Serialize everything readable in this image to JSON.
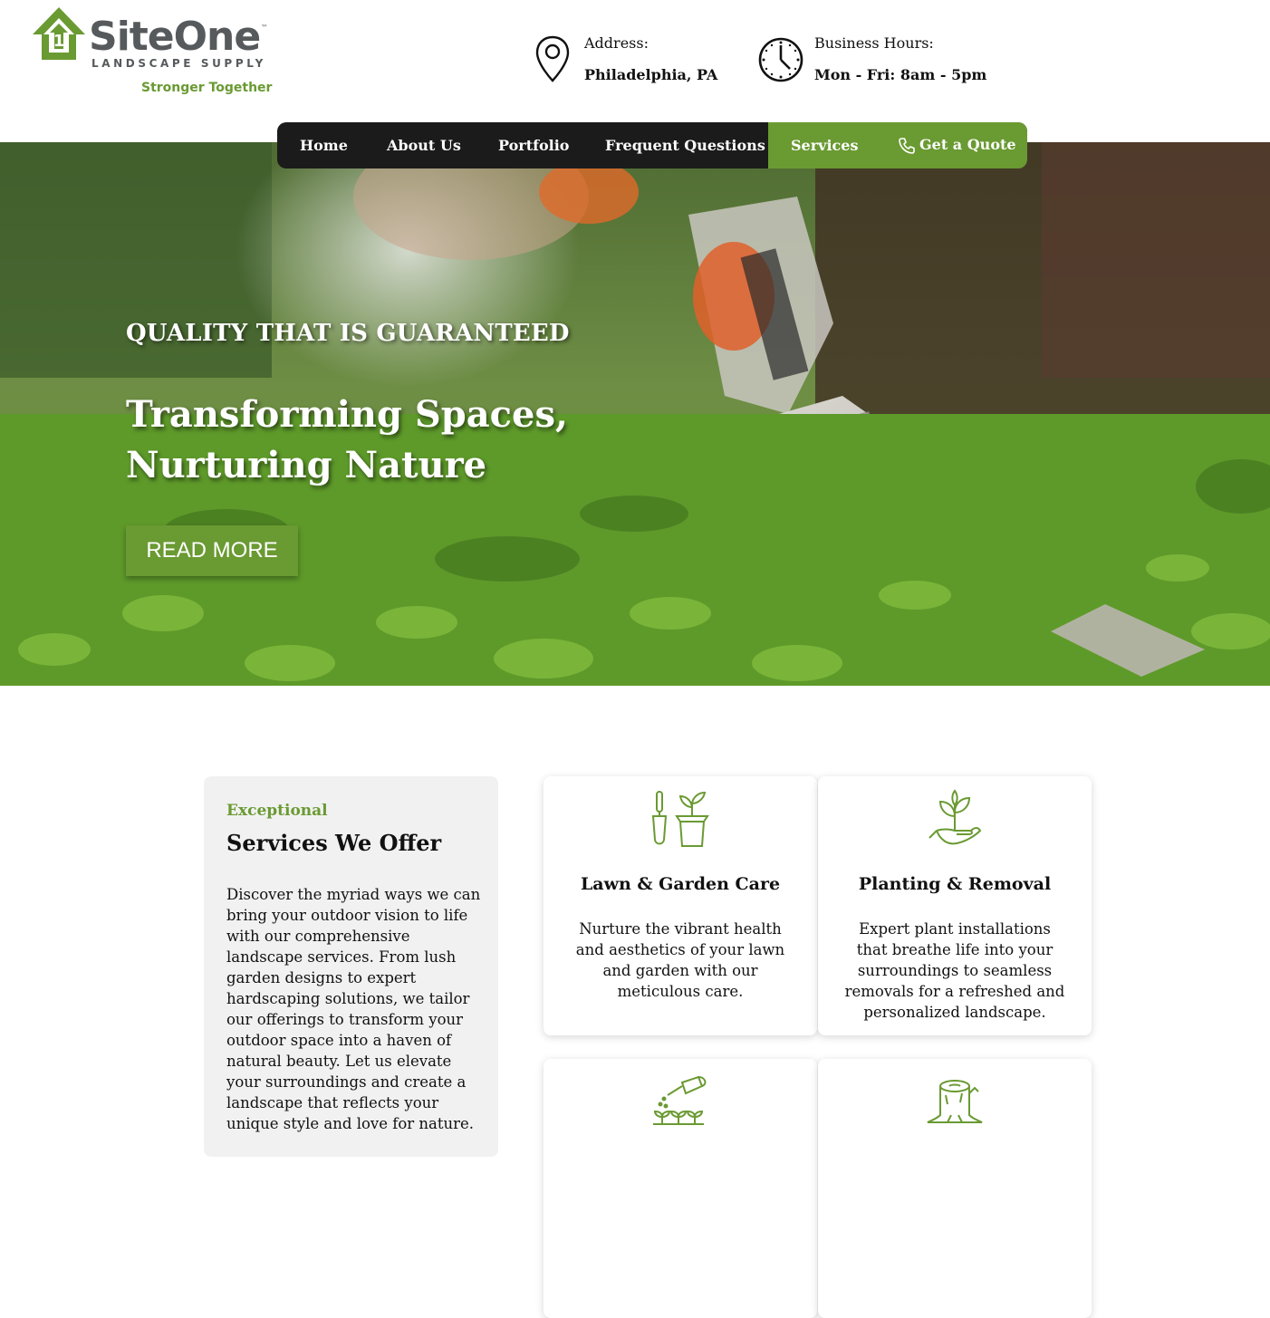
{
  "brand": {
    "name": "SiteOne",
    "tm": "™",
    "subtitle": "LANDSCAPE SUPPLY",
    "tagline": "Stronger Together"
  },
  "contact": {
    "address_label": "Address:",
    "address_value": "Philadelphia, PA",
    "hours_label": "Business Hours:",
    "hours_value": "Mon - Fri: 8am - 5pm"
  },
  "nav": {
    "items": [
      "Home",
      "About Us",
      "Portfolio",
      "Frequent Questions",
      "Services"
    ],
    "quote_label": "Get a Quote"
  },
  "hero": {
    "kicker": "QUALITY THAT IS GUARANTEED",
    "title_line1": "Transforming Spaces,",
    "title_line2": "Nurturing Nature",
    "button_label": "READ MORE"
  },
  "services_intro": {
    "kicker": "Exceptional",
    "title": "Services We Offer",
    "body": "Discover the myriad ways we can bring your outdoor vision to life with our comprehensive landscape services. From lush garden designs to expert hardscaping solutions, we tailor our offerings to transform your outdoor space into a haven of natural beauty. Let us elevate your surroundings and create a landscape that reflects your unique style and love for nature."
  },
  "services": [
    {
      "icon": "garden-tools-icon",
      "title": "Lawn & Garden Care",
      "desc": "Nurture the vibrant health and aesthetics of your lawn and garden with our meticulous care."
    },
    {
      "icon": "plant-in-hand-icon",
      "title": "Planting & Removal",
      "desc": "Expert plant installations that breathe life into your surroundings to seamless removals for a refreshed and personalized landscape."
    },
    {
      "icon": "watering-can-icon",
      "title": "",
      "desc": ""
    },
    {
      "icon": "tree-stump-icon",
      "title": "",
      "desc": ""
    }
  ],
  "colors": {
    "accent": "#6a9a32",
    "nav_bg": "#1b1b1b",
    "logo_gray": "#565a5c"
  }
}
